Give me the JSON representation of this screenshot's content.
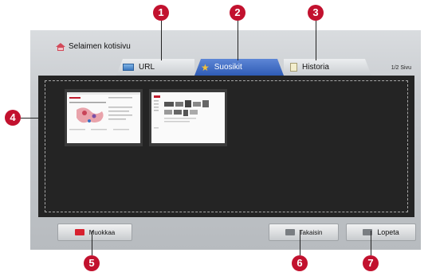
{
  "home_link": {
    "label": "Selaimen kotisivu",
    "icon": "home-icon"
  },
  "tabs": [
    {
      "label": "URL",
      "icon": "url-icon",
      "selected": false
    },
    {
      "label": "Suosikit",
      "icon": "star-icon",
      "selected": true
    },
    {
      "label": "Historia",
      "icon": "history-icon",
      "selected": false
    }
  ],
  "page_indicator": "1/2 Sivu",
  "favorites": [
    {
      "name": "favorite-thumbnail-1"
    },
    {
      "name": "favorite-thumbnail-2"
    }
  ],
  "buttons": {
    "edit": "Muokkaa",
    "back": "Takaisin",
    "exit": "Lopeta"
  },
  "callouts": [
    "1",
    "2",
    "3",
    "4",
    "5",
    "6",
    "7"
  ],
  "colors": {
    "callout": "#c2112e",
    "selected_tab": "#3a67c2",
    "content_bg": "#242424",
    "red_key": "#d7212f"
  }
}
